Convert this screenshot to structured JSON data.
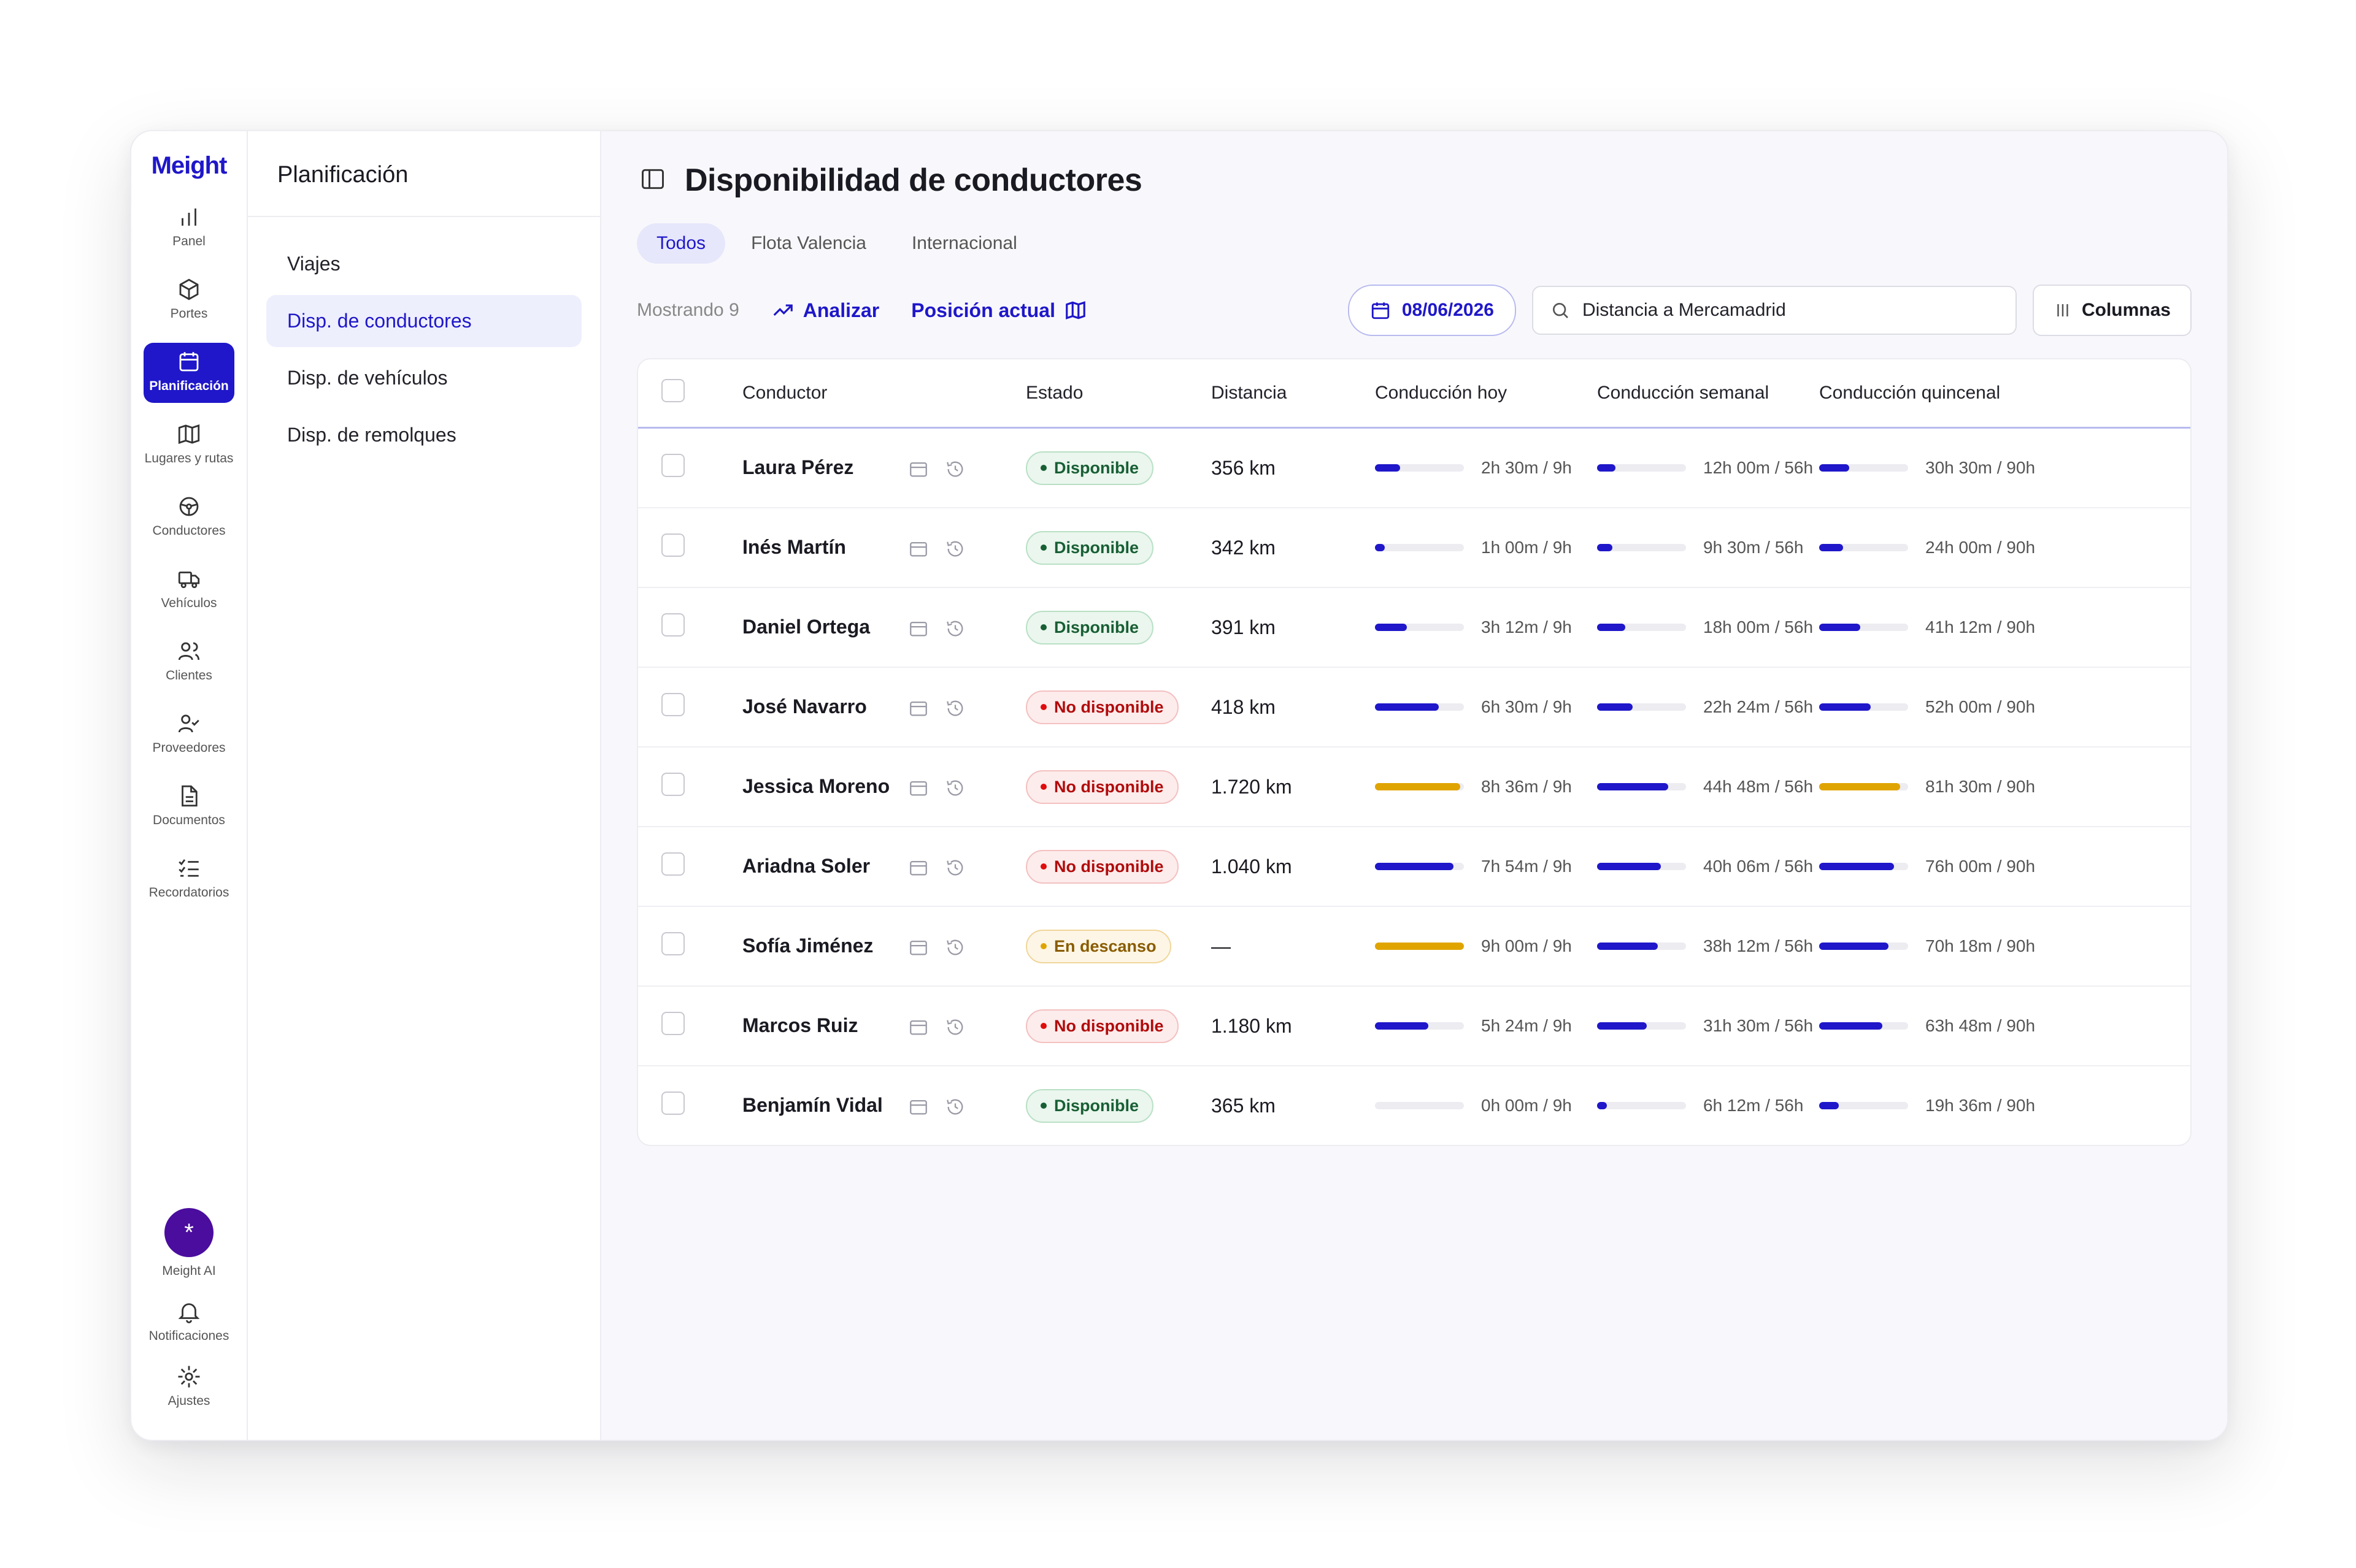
{
  "app": {
    "brand": "Meight"
  },
  "rail": {
    "items": [
      {
        "label": "Panel",
        "icon": "bar-chart-icon"
      },
      {
        "label": "Portes",
        "icon": "box-icon"
      },
      {
        "label": "Planificación",
        "icon": "calendar-icon",
        "active": true
      },
      {
        "label": "Lugares y rutas",
        "icon": "map-icon"
      },
      {
        "label": "Conductores",
        "icon": "steering-wheel-icon"
      },
      {
        "label": "Vehículos",
        "icon": "truck-icon"
      },
      {
        "label": "Clientes",
        "icon": "users-icon"
      },
      {
        "label": "Proveedores",
        "icon": "user-check-icon"
      },
      {
        "label": "Documentos",
        "icon": "document-icon"
      },
      {
        "label": "Recordatorios",
        "icon": "checklist-icon"
      }
    ],
    "bottom": [
      {
        "label": "Meight AI",
        "icon": "sparkle-icon"
      },
      {
        "label": "Notificaciones",
        "icon": "bell-icon"
      },
      {
        "label": "Ajustes",
        "icon": "settings-icon"
      }
    ]
  },
  "subnav": {
    "title": "Planificación",
    "items": [
      "Viajes",
      "Disp. de conductores",
      "Disp. de vehículos",
      "Disp. de remolques"
    ],
    "active_index": 1
  },
  "page": {
    "title": "Disponibilidad de conductores",
    "tabs": [
      "Todos",
      "Flota Valencia",
      "Internacional"
    ],
    "active_tab": 0,
    "showing": "Mostrando 9",
    "analyze_label": "Analizar",
    "position_label": "Posición actual",
    "date": "08/06/2026",
    "search_value": "Distancia a Mercamadrid",
    "columns_label": "Columnas"
  },
  "table": {
    "headers": [
      "Conductor",
      "Estado",
      "Distancia",
      "Conducción hoy",
      "Conducción semanal",
      "Conducción quincenal"
    ],
    "rows": [
      {
        "name": "Laura Pérez",
        "status": "Disponible",
        "status_kind": "ok",
        "distance": "356 km",
        "today": "2h 30m / 9h",
        "today_pct": 28,
        "week": "12h 00m / 56h",
        "week_pct": 21,
        "fort": "30h 30m / 90h",
        "fort_pct": 34
      },
      {
        "name": "Inés Martín",
        "status": "Disponible",
        "status_kind": "ok",
        "distance": "342 km",
        "today": "1h 00m / 9h",
        "today_pct": 11,
        "week": "9h 30m / 56h",
        "week_pct": 17,
        "fort": "24h 00m / 90h",
        "fort_pct": 27
      },
      {
        "name": "Daniel Ortega",
        "status": "Disponible",
        "status_kind": "ok",
        "distance": "391 km",
        "today": "3h 12m / 9h",
        "today_pct": 36,
        "week": "18h 00m / 56h",
        "week_pct": 32,
        "fort": "41h 12m / 90h",
        "fort_pct": 46
      },
      {
        "name": "José Navarro",
        "status": "No disponible",
        "status_kind": "no",
        "distance": "418 km",
        "today": "6h 30m / 9h",
        "today_pct": 72,
        "week": "22h 24m / 56h",
        "week_pct": 40,
        "fort": "52h 00m / 90h",
        "fort_pct": 58
      },
      {
        "name": "Jessica Moreno",
        "status": "No disponible",
        "status_kind": "no",
        "distance": "1.720 km",
        "today": "8h 36m / 9h",
        "today_pct": 96,
        "today_warn": true,
        "week": "44h 48m / 56h",
        "week_pct": 80,
        "fort": "81h 30m / 90h",
        "fort_pct": 91,
        "fort_warn": true
      },
      {
        "name": "Ariadna Soler",
        "status": "No disponible",
        "status_kind": "no",
        "distance": "1.040 km",
        "today": "7h 54m / 9h",
        "today_pct": 88,
        "week": "40h 06m / 56h",
        "week_pct": 72,
        "fort": "76h 00m / 90h",
        "fort_pct": 84
      },
      {
        "name": "Sofía Jiménez",
        "status": "En descanso",
        "status_kind": "rest",
        "distance": "—",
        "today": "9h 00m / 9h",
        "today_pct": 100,
        "today_warn": true,
        "week": "38h 12m / 56h",
        "week_pct": 68,
        "fort": "70h 18m / 90h",
        "fort_pct": 78
      },
      {
        "name": "Marcos Ruiz",
        "status": "No disponible",
        "status_kind": "no",
        "distance": "1.180 km",
        "today": "5h 24m / 9h",
        "today_pct": 60,
        "week": "31h 30m / 56h",
        "week_pct": 56,
        "fort": "63h 48m / 90h",
        "fort_pct": 71
      },
      {
        "name": "Benjamín Vidal",
        "status": "Disponible",
        "status_kind": "ok",
        "distance": "365 km",
        "today": "0h 00m / 9h",
        "today_pct": 0,
        "week": "6h 12m / 56h",
        "week_pct": 11,
        "fort": "19h 36m / 90h",
        "fort_pct": 22
      }
    ]
  }
}
